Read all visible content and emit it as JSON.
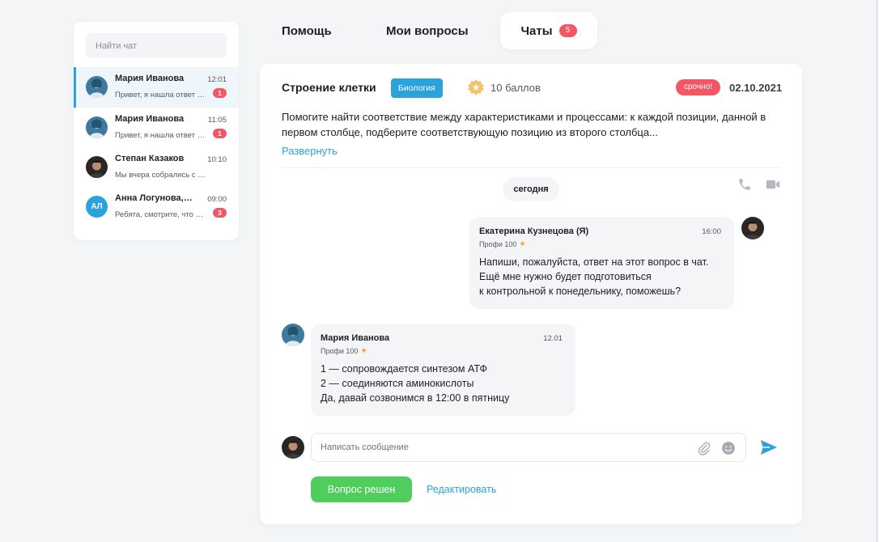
{
  "sidebar": {
    "search_placeholder": "Найти чат",
    "chats": [
      {
        "name": "Мария Иванова",
        "time": "12:01",
        "preview": "Привет, я нашла ответ на твой вопрос",
        "unread": "1",
        "active": true
      },
      {
        "name": "Мария Иванова",
        "time": "11:05",
        "preview": "Привет, я нашла ответ на твой вопрос",
        "unread": "1",
        "active": false
      },
      {
        "name": "Степан Казаков",
        "time": "10:10",
        "preview": "Мы вчера собрались с группой",
        "unread": "",
        "active": false
      },
      {
        "name": "Анна Логунова, Андрей",
        "time": "09:00",
        "preview": "Ребята, смотрите, что я нашла",
        "unread": "3",
        "active": false,
        "initials": "АЛ"
      }
    ]
  },
  "tabs": {
    "help": "Помощь",
    "my_questions": "Мои вопросы",
    "chats": "Чаты",
    "chats_badge": "5"
  },
  "question": {
    "title": "Строение клетки",
    "subject": "Биология",
    "points": "10 баллов",
    "urgent": "срочно!",
    "date": "02.10.2021",
    "body": "Помогите найти соответствие между характеристиками и процессами: к каждой позиции, данной в первом столбце, подберите соответствующую позицию из второго столбца...",
    "expand": "Развернуть"
  },
  "chat": {
    "day": "сегодня",
    "messages": [
      {
        "author": "Екатерина Кузнецова (Я)",
        "time": "16:00",
        "role": "Профи 100",
        "text": "Напиши, пожалуйста, ответ на этот вопрос в чат.\nЕщё мне нужно будет подготовиться\nк контрольной к понедельнику, поможешь?"
      },
      {
        "author": "Мария Иванова",
        "time": "12.01",
        "role": "Профи 100",
        "text": "1 — сопровождается синтезом АТФ\n2 — соединяются аминокислоты\nДа, давай созвонимся в 12:00 в пятницу"
      }
    ],
    "composer_placeholder": "Написать сообщение"
  },
  "actions": {
    "solved": "Вопрос решен",
    "edit": "Редактировать"
  },
  "colors": {
    "accent": "#2aa3dc",
    "badge": "#f25766",
    "success": "#4fce5d",
    "star": "#f5a623"
  }
}
